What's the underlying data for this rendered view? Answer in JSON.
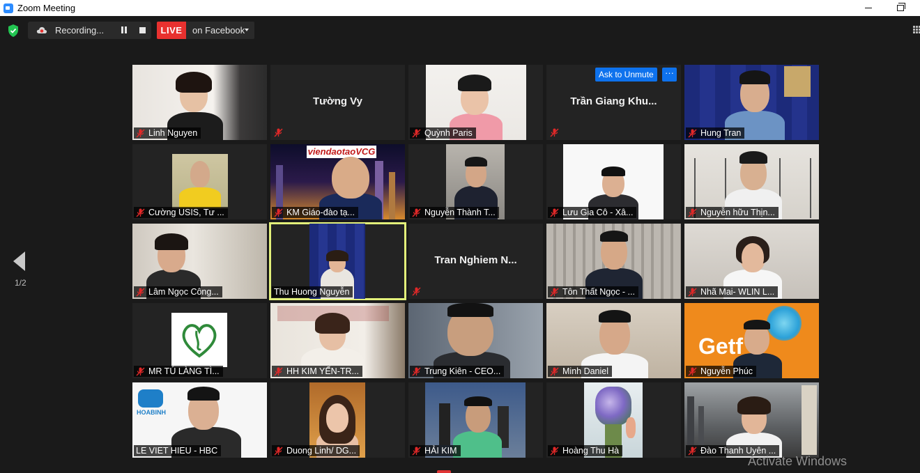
{
  "window": {
    "title": "Zoom Meeting"
  },
  "topbar": {
    "recording_label": "Recording...",
    "live_label": "LIVE",
    "live_destination": "on Facebook"
  },
  "pager": {
    "indicator": "1/2"
  },
  "tiles": [
    {
      "name": "Linh Nguyen",
      "video": true
    },
    {
      "name": "Tường Vy",
      "video": false
    },
    {
      "name": "Quỳnh Paris",
      "video": true
    },
    {
      "name": "Trần Giang Khu...",
      "video": false,
      "ask_unmute": "Ask to Unmute",
      "more": "···"
    },
    {
      "name": "Hung Tran",
      "video": true
    },
    {
      "name": "Cường USIS, Tư ...",
      "video": true
    },
    {
      "name": "KM Giáo-đào tạ...",
      "video": true,
      "banner": "viendaotaoVCG"
    },
    {
      "name": "Nguyễn Thành T...",
      "video": true
    },
    {
      "name": "Lưu Gia Cô -  Xâ...",
      "video": true
    },
    {
      "name": "Nguyễn hữu Thịn...",
      "video": true
    },
    {
      "name": "Lâm Ngọc  Công...",
      "video": true
    },
    {
      "name": "Thu Huong Nguyễn",
      "video": true,
      "active": true
    },
    {
      "name": "Tran Nghiem N...",
      "video": false
    },
    {
      "name": "Tôn Thất Ngọc - ...",
      "video": true
    },
    {
      "name": "Nhã Mai- WLIN L...",
      "video": true
    },
    {
      "name": "MR TÚ  LÀNG TÌ...",
      "video": true
    },
    {
      "name": "HH KIM YẾN-TR...",
      "video": true
    },
    {
      "name": "Trung Kiên - CEO...",
      "video": true
    },
    {
      "name": "Minh Daniel",
      "video": true
    },
    {
      "name": "Nguyễn Phúc",
      "video": true,
      "logo": "Getf"
    },
    {
      "name": "LE VIET HIEU - HBC",
      "video": true,
      "logo": "HOABINH"
    },
    {
      "name": "Duong Linh/ DG...",
      "video": true
    },
    {
      "name": "HẢI KIM",
      "video": true
    },
    {
      "name": "Hoàng Thu Hà",
      "video": true
    },
    {
      "name": "Đào Thanh Uyên ...",
      "video": true
    }
  ],
  "overlay": {
    "watermark": "Activate Windows"
  },
  "colors": {
    "accent_blue": "#0e72ed",
    "live_red": "#e8312f",
    "active_speaker": "#e2f07a",
    "mute_red": "#e02828"
  }
}
